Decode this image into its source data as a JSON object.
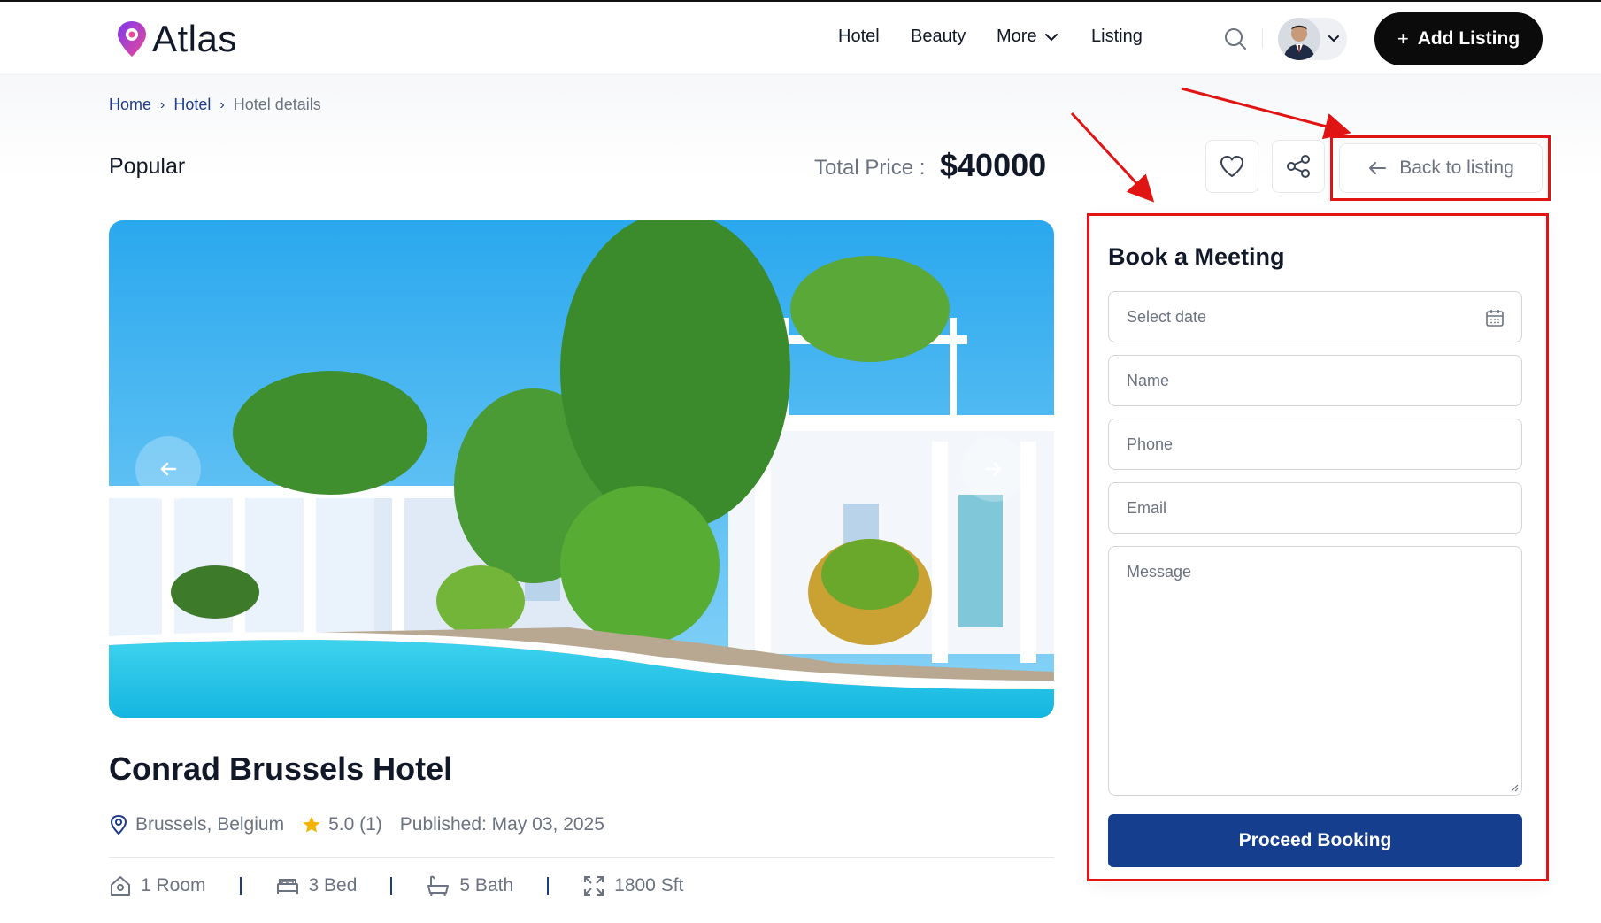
{
  "header": {
    "brand": "Atlas",
    "nav": [
      {
        "label": "Hotel"
      },
      {
        "label": "Beauty"
      },
      {
        "label": "More"
      },
      {
        "label": "Listing"
      }
    ],
    "add_listing_label": "Add Listing"
  },
  "breadcrumb": {
    "home": "Home",
    "hotel": "Hotel",
    "current": "Hotel details"
  },
  "listing": {
    "status": "Popular",
    "price_label": "Total Price :",
    "price_value": "$40000",
    "back_label": "Back to listing",
    "title": "Conrad Brussels Hotel",
    "location": "Brussels, Belgium",
    "rating": "5.0 (1)",
    "published": "Published: May 03, 2025",
    "features": [
      "1 Room",
      "3 Bed",
      "5 Bath",
      "1800 Sft"
    ]
  },
  "booking": {
    "title": "Book a Meeting",
    "date_placeholder": "Select date",
    "name_placeholder": "Name",
    "phone_placeholder": "Phone",
    "email_placeholder": "Email",
    "message_placeholder": "Message",
    "submit_label": "Proceed Booking"
  },
  "colors": {
    "brand_navy": "#153e8e",
    "annotation_red": "#e11414",
    "primary_dark": "#0b0b0b"
  }
}
